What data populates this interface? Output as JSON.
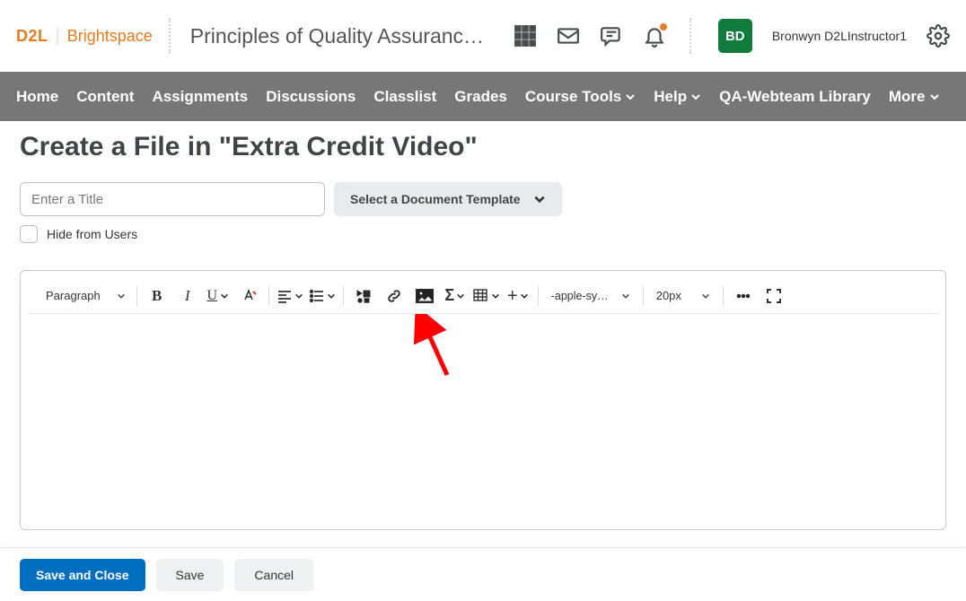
{
  "brand": {
    "logo_left": "D2L",
    "logo_right": "Brightspace"
  },
  "header": {
    "course_title": "Principles of Quality Assuranc…",
    "avatar_initials": "BD",
    "username": "Bronwyn D2LInstructor1"
  },
  "nav": {
    "items": [
      "Home",
      "Content",
      "Assignments",
      "Discussions",
      "Classlist",
      "Grades",
      "Course Tools",
      "Help",
      "QA-Webteam Library",
      "More"
    ],
    "has_dropdown": [
      false,
      false,
      false,
      false,
      false,
      false,
      true,
      true,
      false,
      true
    ]
  },
  "page": {
    "title": "Create a File in \"Extra Credit Video\"",
    "title_placeholder": "Enter a Title",
    "template_button": "Select a Document Template",
    "hide_label": "Hide from Users"
  },
  "editor": {
    "paragraph_label": "Paragraph",
    "font_family": "-apple-syste…",
    "font_size": "20px"
  },
  "footer": {
    "save_close": "Save and Close",
    "save": "Save",
    "cancel": "Cancel"
  }
}
